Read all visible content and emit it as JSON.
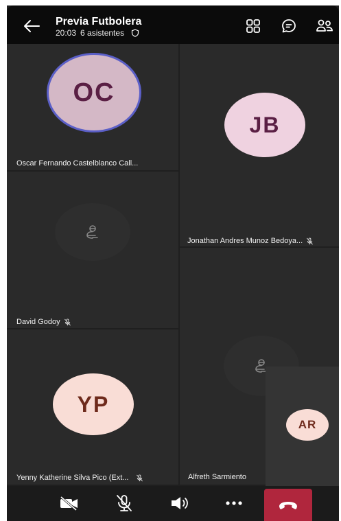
{
  "header": {
    "title": "Previa Futbolera",
    "time": "20:03",
    "attendees": "6 asistentes"
  },
  "participants": [
    {
      "initials": "OC",
      "name": "Oscar Fernando Castelblanco Call..."
    },
    {
      "initials": "JB",
      "name": "Jonathan Andres Munoz Bedoya..."
    },
    {
      "initials": "",
      "name": "David Godoy"
    },
    {
      "initials": "",
      "name": "Alfreth Sarmiento"
    },
    {
      "initials": "YP",
      "name": "Yenny Katherine Silva Pico (Ext..."
    },
    {
      "initials": "AR",
      "name": ""
    }
  ],
  "icons": {
    "back": "arrow-left-icon",
    "shield": "shield-icon",
    "layout": "grid-layout-icon",
    "chat": "chat-icon",
    "people": "people-icon",
    "camera": "camera-off-icon",
    "mic": "mic-off-icon",
    "speaker": "speaker-icon",
    "more": "more-icon",
    "hangup": "hang-up-icon"
  },
  "colors": {
    "header_bg": "#0b0b0b",
    "tile_bg": "#2a2a2a",
    "hangup": "#b0263d",
    "avatar_oc": "#d4b8c6",
    "avatar_jb": "#efd2e0",
    "avatar_yp": "#f9ddd6",
    "avatar_ar": "#f9ddd6",
    "initials_purple": "#5a1f44",
    "initials_brown": "#6e2a1c"
  }
}
